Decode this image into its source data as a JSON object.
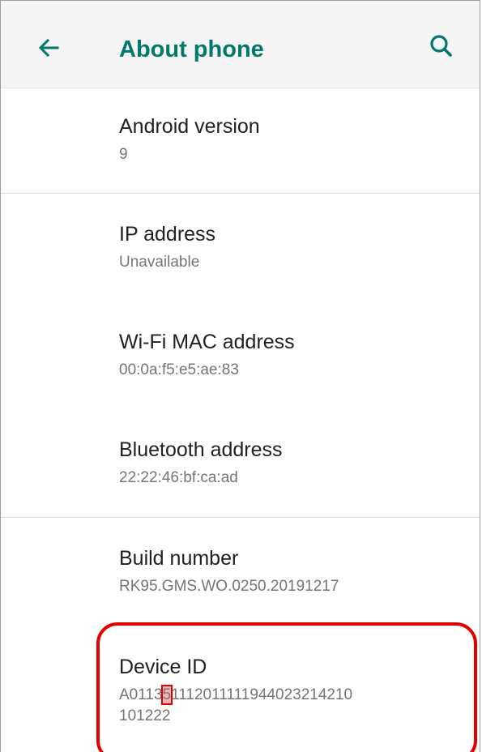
{
  "header": {
    "title": "About phone",
    "back_icon": "arrow-left-icon",
    "search_icon": "search-icon",
    "accent_color": "#00796b"
  },
  "items": [
    {
      "title": "Android version",
      "value": "9"
    },
    {
      "title": "IP address",
      "value": "Unavailable"
    },
    {
      "title": "Wi-Fi MAC address",
      "value": "00:0a:f5:e5:ae:83"
    },
    {
      "title": "Bluetooth address",
      "value": "22:22:46:bf:ca:ad"
    },
    {
      "title": "Build number",
      "value": "RK95.GMS.WO.0250.20191217"
    },
    {
      "title": "Device ID",
      "value_prefix": "A0113",
      "value_highlight": "5",
      "value_suffix": "1112011111944023214210",
      "value_line2": "101222"
    }
  ],
  "annotation": {
    "highlight_color": "#e00000"
  }
}
